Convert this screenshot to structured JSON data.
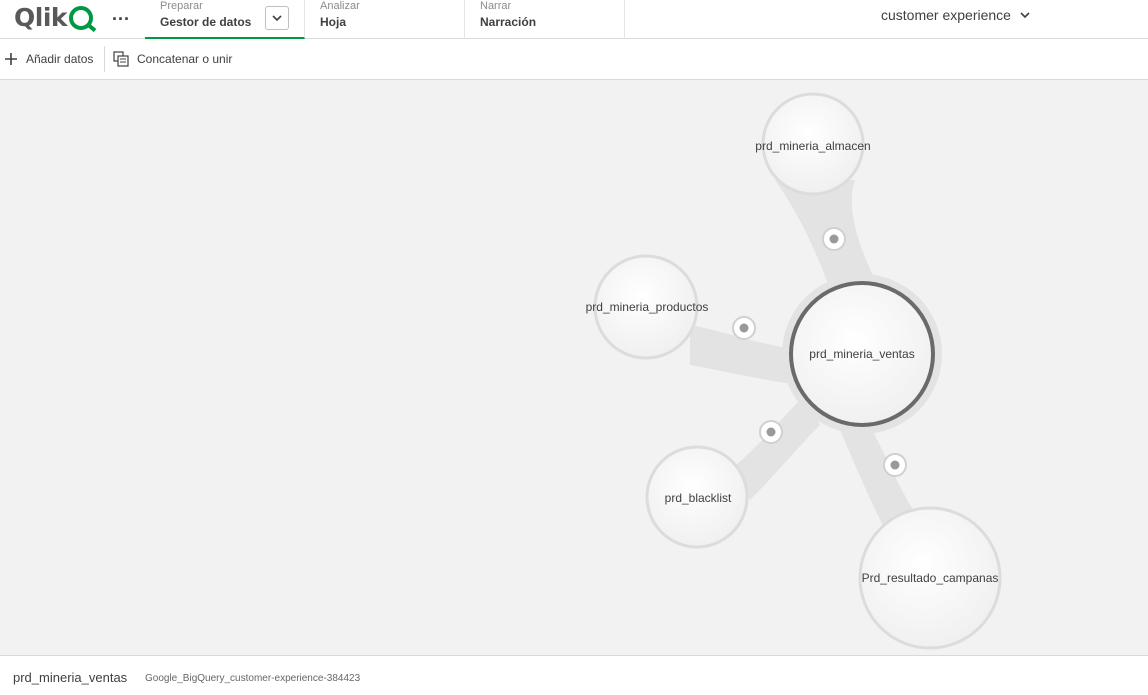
{
  "header": {
    "logo_text": "Qlik",
    "more_menu": "...",
    "tabs": [
      {
        "small": "Preparar",
        "big": "Gestor de datos"
      },
      {
        "small": "Analizar",
        "big": "Hoja"
      },
      {
        "small": "Narrar",
        "big": "Narración"
      }
    ],
    "app_name": "customer experience"
  },
  "toolbar": {
    "add_label": "Añadir datos",
    "concat_label": "Concatenar o unir"
  },
  "canvas": {
    "tables": [
      {
        "label": "prd_mineria_almacen"
      },
      {
        "label": "prd_mineria_productos"
      },
      {
        "label": "prd_mineria_ventas"
      },
      {
        "label": "prd_blacklist"
      },
      {
        "label": "Prd_resultado_campanas"
      }
    ]
  },
  "footer": {
    "selected_table": "prd_mineria_ventas",
    "source": "Google_BigQuery_customer-experience-384423"
  },
  "colors": {
    "accent": "#009845",
    "canvas_bg": "#f2f2f2",
    "link_fill": "#e3e3e3",
    "selected_ring": "#6a6a6a"
  }
}
